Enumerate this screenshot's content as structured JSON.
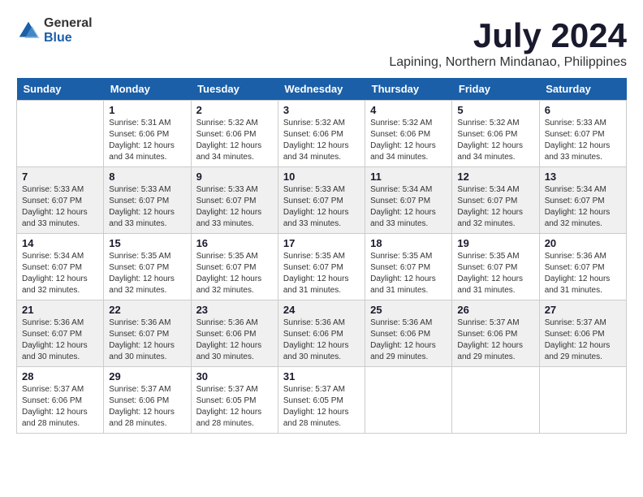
{
  "logo": {
    "general": "General",
    "blue": "Blue"
  },
  "title": "July 2024",
  "location": "Lapining, Northern Mindanao, Philippines",
  "headers": [
    "Sunday",
    "Monday",
    "Tuesday",
    "Wednesday",
    "Thursday",
    "Friday",
    "Saturday"
  ],
  "weeks": [
    [
      {
        "day": "",
        "detail": ""
      },
      {
        "day": "1",
        "detail": "Sunrise: 5:31 AM\nSunset: 6:06 PM\nDaylight: 12 hours\nand 34 minutes."
      },
      {
        "day": "2",
        "detail": "Sunrise: 5:32 AM\nSunset: 6:06 PM\nDaylight: 12 hours\nand 34 minutes."
      },
      {
        "day": "3",
        "detail": "Sunrise: 5:32 AM\nSunset: 6:06 PM\nDaylight: 12 hours\nand 34 minutes."
      },
      {
        "day": "4",
        "detail": "Sunrise: 5:32 AM\nSunset: 6:06 PM\nDaylight: 12 hours\nand 34 minutes."
      },
      {
        "day": "5",
        "detail": "Sunrise: 5:32 AM\nSunset: 6:06 PM\nDaylight: 12 hours\nand 34 minutes."
      },
      {
        "day": "6",
        "detail": "Sunrise: 5:33 AM\nSunset: 6:07 PM\nDaylight: 12 hours\nand 33 minutes."
      }
    ],
    [
      {
        "day": "7",
        "detail": "Sunrise: 5:33 AM\nSunset: 6:07 PM\nDaylight: 12 hours\nand 33 minutes."
      },
      {
        "day": "8",
        "detail": "Sunrise: 5:33 AM\nSunset: 6:07 PM\nDaylight: 12 hours\nand 33 minutes."
      },
      {
        "day": "9",
        "detail": "Sunrise: 5:33 AM\nSunset: 6:07 PM\nDaylight: 12 hours\nand 33 minutes."
      },
      {
        "day": "10",
        "detail": "Sunrise: 5:33 AM\nSunset: 6:07 PM\nDaylight: 12 hours\nand 33 minutes."
      },
      {
        "day": "11",
        "detail": "Sunrise: 5:34 AM\nSunset: 6:07 PM\nDaylight: 12 hours\nand 33 minutes."
      },
      {
        "day": "12",
        "detail": "Sunrise: 5:34 AM\nSunset: 6:07 PM\nDaylight: 12 hours\nand 32 minutes."
      },
      {
        "day": "13",
        "detail": "Sunrise: 5:34 AM\nSunset: 6:07 PM\nDaylight: 12 hours\nand 32 minutes."
      }
    ],
    [
      {
        "day": "14",
        "detail": "Sunrise: 5:34 AM\nSunset: 6:07 PM\nDaylight: 12 hours\nand 32 minutes."
      },
      {
        "day": "15",
        "detail": "Sunrise: 5:35 AM\nSunset: 6:07 PM\nDaylight: 12 hours\nand 32 minutes."
      },
      {
        "day": "16",
        "detail": "Sunrise: 5:35 AM\nSunset: 6:07 PM\nDaylight: 12 hours\nand 32 minutes."
      },
      {
        "day": "17",
        "detail": "Sunrise: 5:35 AM\nSunset: 6:07 PM\nDaylight: 12 hours\nand 31 minutes."
      },
      {
        "day": "18",
        "detail": "Sunrise: 5:35 AM\nSunset: 6:07 PM\nDaylight: 12 hours\nand 31 minutes."
      },
      {
        "day": "19",
        "detail": "Sunrise: 5:35 AM\nSunset: 6:07 PM\nDaylight: 12 hours\nand 31 minutes."
      },
      {
        "day": "20",
        "detail": "Sunrise: 5:36 AM\nSunset: 6:07 PM\nDaylight: 12 hours\nand 31 minutes."
      }
    ],
    [
      {
        "day": "21",
        "detail": "Sunrise: 5:36 AM\nSunset: 6:07 PM\nDaylight: 12 hours\nand 30 minutes."
      },
      {
        "day": "22",
        "detail": "Sunrise: 5:36 AM\nSunset: 6:07 PM\nDaylight: 12 hours\nand 30 minutes."
      },
      {
        "day": "23",
        "detail": "Sunrise: 5:36 AM\nSunset: 6:06 PM\nDaylight: 12 hours\nand 30 minutes."
      },
      {
        "day": "24",
        "detail": "Sunrise: 5:36 AM\nSunset: 6:06 PM\nDaylight: 12 hours\nand 30 minutes."
      },
      {
        "day": "25",
        "detail": "Sunrise: 5:36 AM\nSunset: 6:06 PM\nDaylight: 12 hours\nand 29 minutes."
      },
      {
        "day": "26",
        "detail": "Sunrise: 5:37 AM\nSunset: 6:06 PM\nDaylight: 12 hours\nand 29 minutes."
      },
      {
        "day": "27",
        "detail": "Sunrise: 5:37 AM\nSunset: 6:06 PM\nDaylight: 12 hours\nand 29 minutes."
      }
    ],
    [
      {
        "day": "28",
        "detail": "Sunrise: 5:37 AM\nSunset: 6:06 PM\nDaylight: 12 hours\nand 28 minutes."
      },
      {
        "day": "29",
        "detail": "Sunrise: 5:37 AM\nSunset: 6:06 PM\nDaylight: 12 hours\nand 28 minutes."
      },
      {
        "day": "30",
        "detail": "Sunrise: 5:37 AM\nSunset: 6:05 PM\nDaylight: 12 hours\nand 28 minutes."
      },
      {
        "day": "31",
        "detail": "Sunrise: 5:37 AM\nSunset: 6:05 PM\nDaylight: 12 hours\nand 28 minutes."
      },
      {
        "day": "",
        "detail": ""
      },
      {
        "day": "",
        "detail": ""
      },
      {
        "day": "",
        "detail": ""
      }
    ]
  ]
}
